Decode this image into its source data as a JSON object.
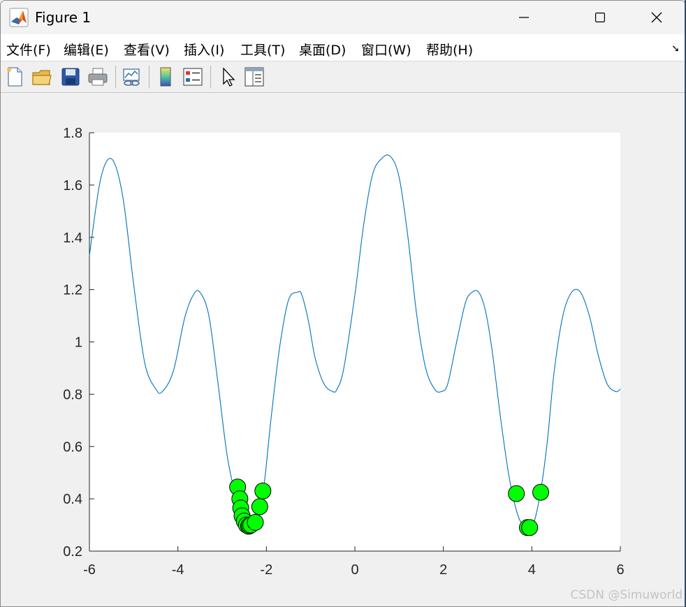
{
  "window": {
    "title": "Figure 1",
    "controls": {
      "minimize": "─",
      "maximize": "☐",
      "close": "✕"
    }
  },
  "menu": {
    "items": [
      "文件(F)",
      "编辑(E)",
      "查看(V)",
      "插入(I)",
      "工具(T)",
      "桌面(D)",
      "窗口(W)",
      "帮助(H)"
    ],
    "dock": "➘"
  },
  "toolbar": {
    "icons": [
      "new-figure-icon",
      "open-file-icon",
      "save-icon",
      "print-icon",
      "link-plot-icon",
      "colorbar-icon",
      "legend-icon",
      "pointer-icon",
      "property-inspector-icon"
    ]
  },
  "watermark": "CSDN @Simuworld",
  "colors": {
    "line": "#0072bd",
    "marker_fill": "#00ff00",
    "marker_edge": "#000000",
    "axes_bg": "#ffffff",
    "figure_bg": "#f0f0f0"
  },
  "chart_data": {
    "type": "line",
    "title": "",
    "xlabel": "",
    "ylabel": "",
    "xlim": [
      -6,
      6
    ],
    "ylim": [
      0.2,
      1.8
    ],
    "xticks": [
      -6,
      -4,
      -2,
      0,
      2,
      4,
      6
    ],
    "yticks": [
      0.2,
      0.4,
      0.6,
      0.8,
      1.0,
      1.2,
      1.4,
      1.6,
      1.8
    ],
    "xtick_labels": [
      "-6",
      "-4",
      "-2",
      "0",
      "2",
      "4",
      "6"
    ],
    "ytick_labels": [
      "0.2",
      "0.4",
      "0.6",
      "0.8",
      "1",
      "1.2",
      "1.4",
      "1.6",
      "1.8"
    ],
    "series": [
      {
        "style": "line",
        "x": [
          -6.0,
          -5.75,
          -5.5,
          -5.25,
          -5.0,
          -4.75,
          -4.5,
          -4.35,
          -4.1,
          -3.85,
          -3.65,
          -3.5,
          -3.3,
          -3.1,
          -2.9,
          -2.75,
          -2.6,
          -2.5,
          -2.4,
          -2.3,
          -2.2,
          -2.05,
          -1.9,
          -1.7,
          -1.5,
          -1.3,
          -1.2,
          -1.05,
          -0.9,
          -0.7,
          -0.5,
          -0.4,
          -0.25,
          0.0,
          0.2,
          0.4,
          0.6,
          0.8,
          1.0,
          1.2,
          1.4,
          1.6,
          1.8,
          1.95,
          2.1,
          2.3,
          2.5,
          2.65,
          2.8,
          2.95,
          3.1,
          3.3,
          3.5,
          3.7,
          3.85,
          3.95,
          4.05,
          4.2,
          4.35,
          4.5,
          4.7,
          4.9,
          5.1,
          5.3,
          5.5,
          5.7,
          5.9,
          6.0
        ],
        "y": [
          1.33,
          1.62,
          1.7,
          1.56,
          1.22,
          0.92,
          0.82,
          0.81,
          0.89,
          1.09,
          1.18,
          1.19,
          1.1,
          0.85,
          0.58,
          0.45,
          0.36,
          0.32,
          0.3,
          0.31,
          0.36,
          0.46,
          0.7,
          0.98,
          1.16,
          1.19,
          1.18,
          1.08,
          0.94,
          0.84,
          0.81,
          0.82,
          0.9,
          1.18,
          1.45,
          1.64,
          1.7,
          1.71,
          1.63,
          1.4,
          1.1,
          0.9,
          0.82,
          0.81,
          0.84,
          1.0,
          1.15,
          1.19,
          1.19,
          1.12,
          0.97,
          0.7,
          0.47,
          0.33,
          0.3,
          0.29,
          0.31,
          0.43,
          0.62,
          0.88,
          1.1,
          1.19,
          1.19,
          1.1,
          0.95,
          0.84,
          0.81,
          0.82
        ]
      },
      {
        "style": "markers",
        "x": [
          -2.65,
          -2.6,
          -2.58,
          -2.55,
          -2.5,
          -2.45,
          -2.4,
          -2.38,
          -2.35,
          -2.25,
          -2.15,
          -2.08,
          3.65,
          3.9,
          3.95,
          4.2
        ],
        "y": [
          0.445,
          0.4,
          0.365,
          0.335,
          0.315,
          0.3,
          0.295,
          0.298,
          0.3,
          0.31,
          0.37,
          0.43,
          0.42,
          0.29,
          0.29,
          0.425
        ]
      }
    ]
  }
}
